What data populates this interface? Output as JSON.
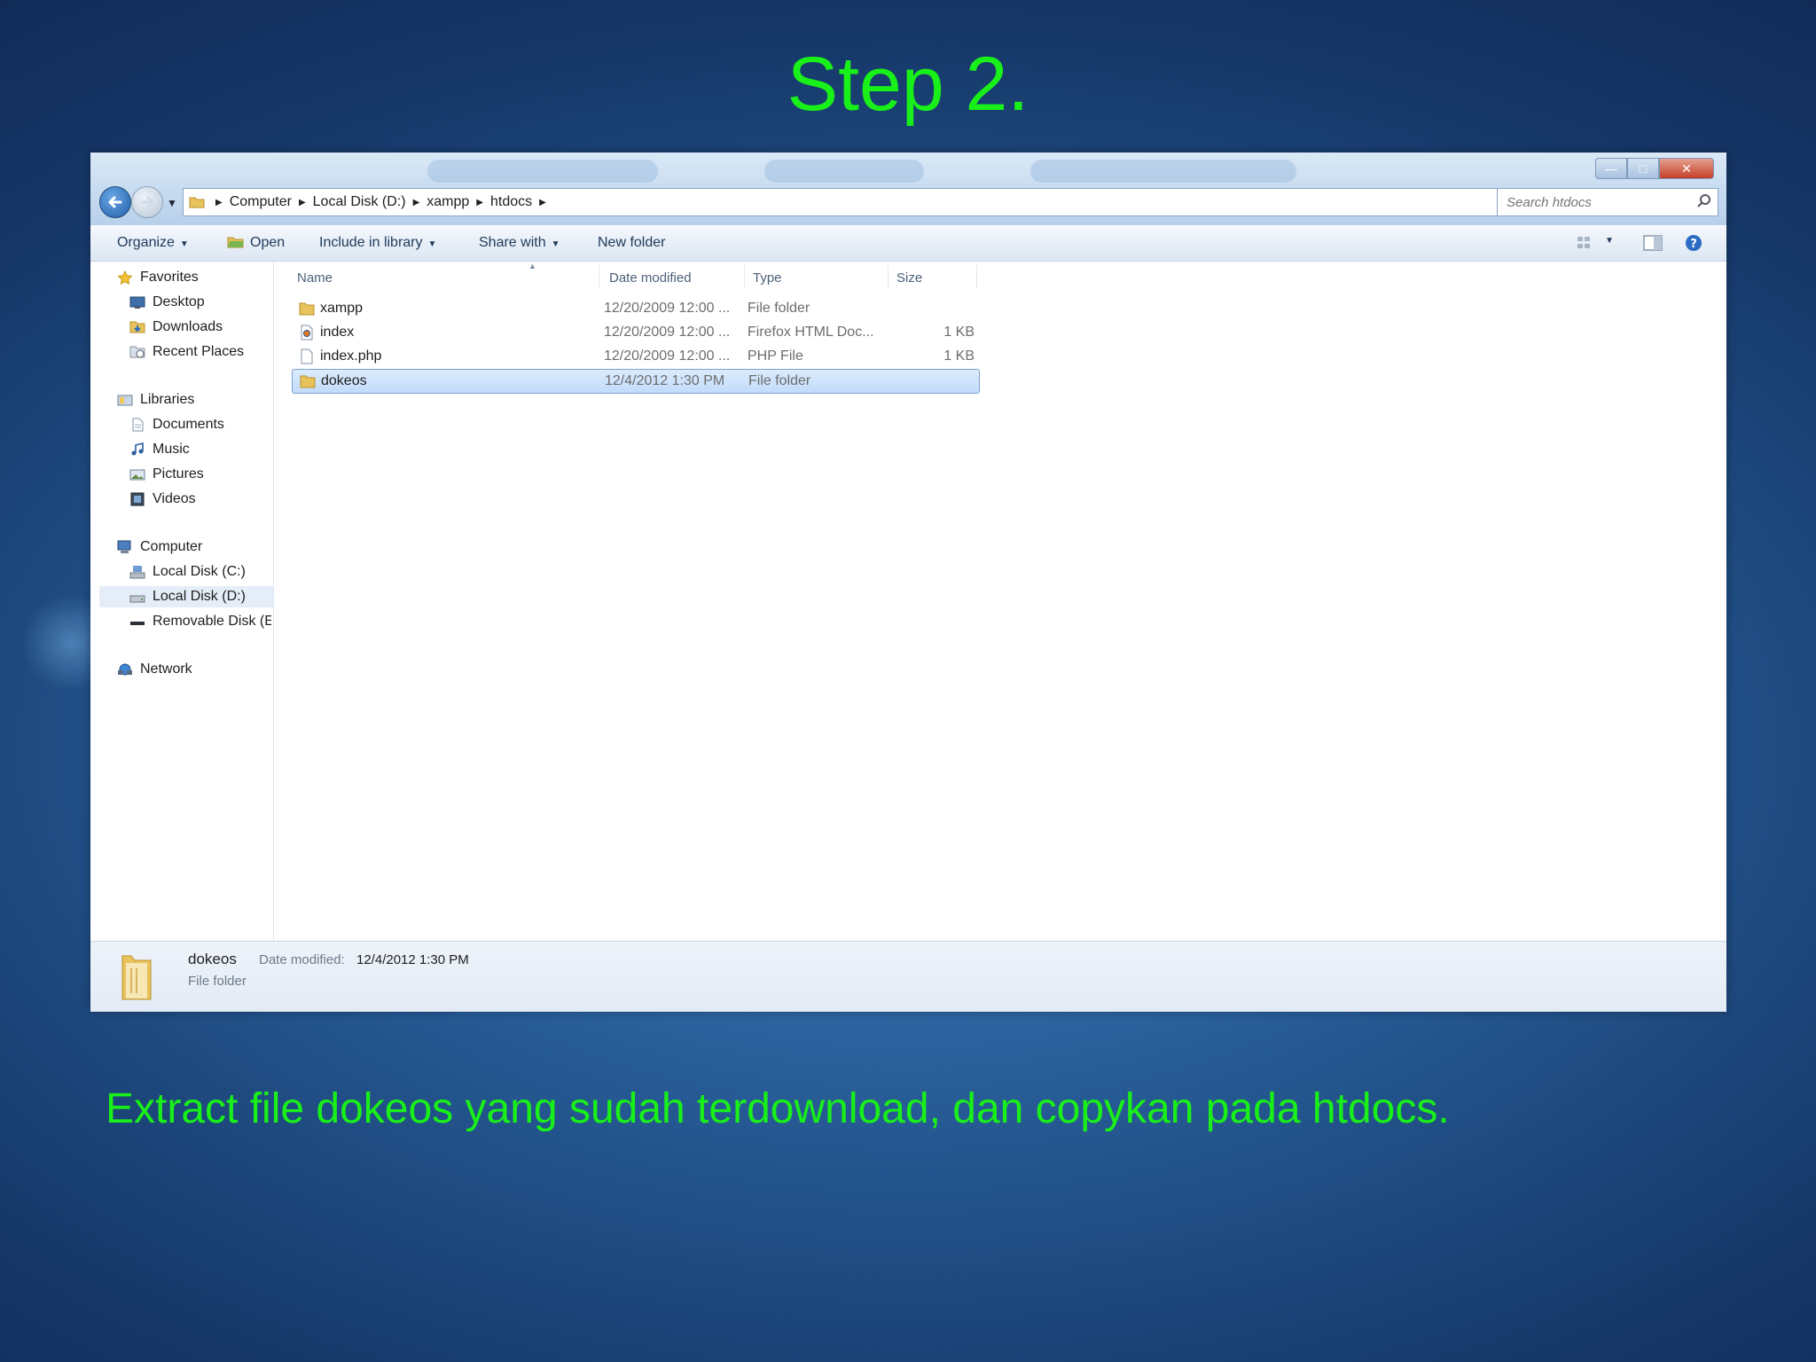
{
  "slide": {
    "title": "Step 2.",
    "caption": "Extract file dokeos yang sudah terdownload, dan copykan pada htdocs."
  },
  "explorer": {
    "breadcrumb": [
      "Computer",
      "Local Disk (D:)",
      "xampp",
      "htdocs"
    ],
    "search": {
      "placeholder": "Search htdocs"
    },
    "toolbar": {
      "organize": "Organize",
      "open": "Open",
      "include_in_library": "Include in library",
      "share_with": "Share with",
      "new_folder": "New folder"
    },
    "nav": {
      "favorites": "Favorites",
      "desktop": "Desktop",
      "downloads": "Downloads",
      "recent_places": "Recent Places",
      "libraries": "Libraries",
      "documents": "Documents",
      "music": "Music",
      "pictures": "Pictures",
      "videos": "Videos",
      "computer": "Computer",
      "local_c": "Local Disk (C:)",
      "local_d": "Local Disk (D:)",
      "removable": "Removable Disk (E:)",
      "network": "Network"
    },
    "columns": {
      "name": "Name",
      "date": "Date modified",
      "type": "Type",
      "size": "Size"
    },
    "files": [
      {
        "name": "xampp",
        "date": "12/20/2009 12:00 ...",
        "type": "File folder",
        "size": ""
      },
      {
        "name": "index",
        "date": "12/20/2009 12:00 ...",
        "type": "Firefox HTML Doc...",
        "size": "1 KB"
      },
      {
        "name": "index.php",
        "date": "12/20/2009 12:00 ...",
        "type": "PHP File",
        "size": "1 KB"
      },
      {
        "name": "dokeos",
        "date": "12/4/2012 1:30 PM",
        "type": "File folder",
        "size": ""
      }
    ],
    "details": {
      "name": "dokeos",
      "date_label": "Date modified:",
      "date_value": "12/4/2012 1:30 PM",
      "type": "File folder"
    },
    "colors": {
      "selection": "#c1dcfc",
      "caption_green": "#19f019"
    }
  }
}
